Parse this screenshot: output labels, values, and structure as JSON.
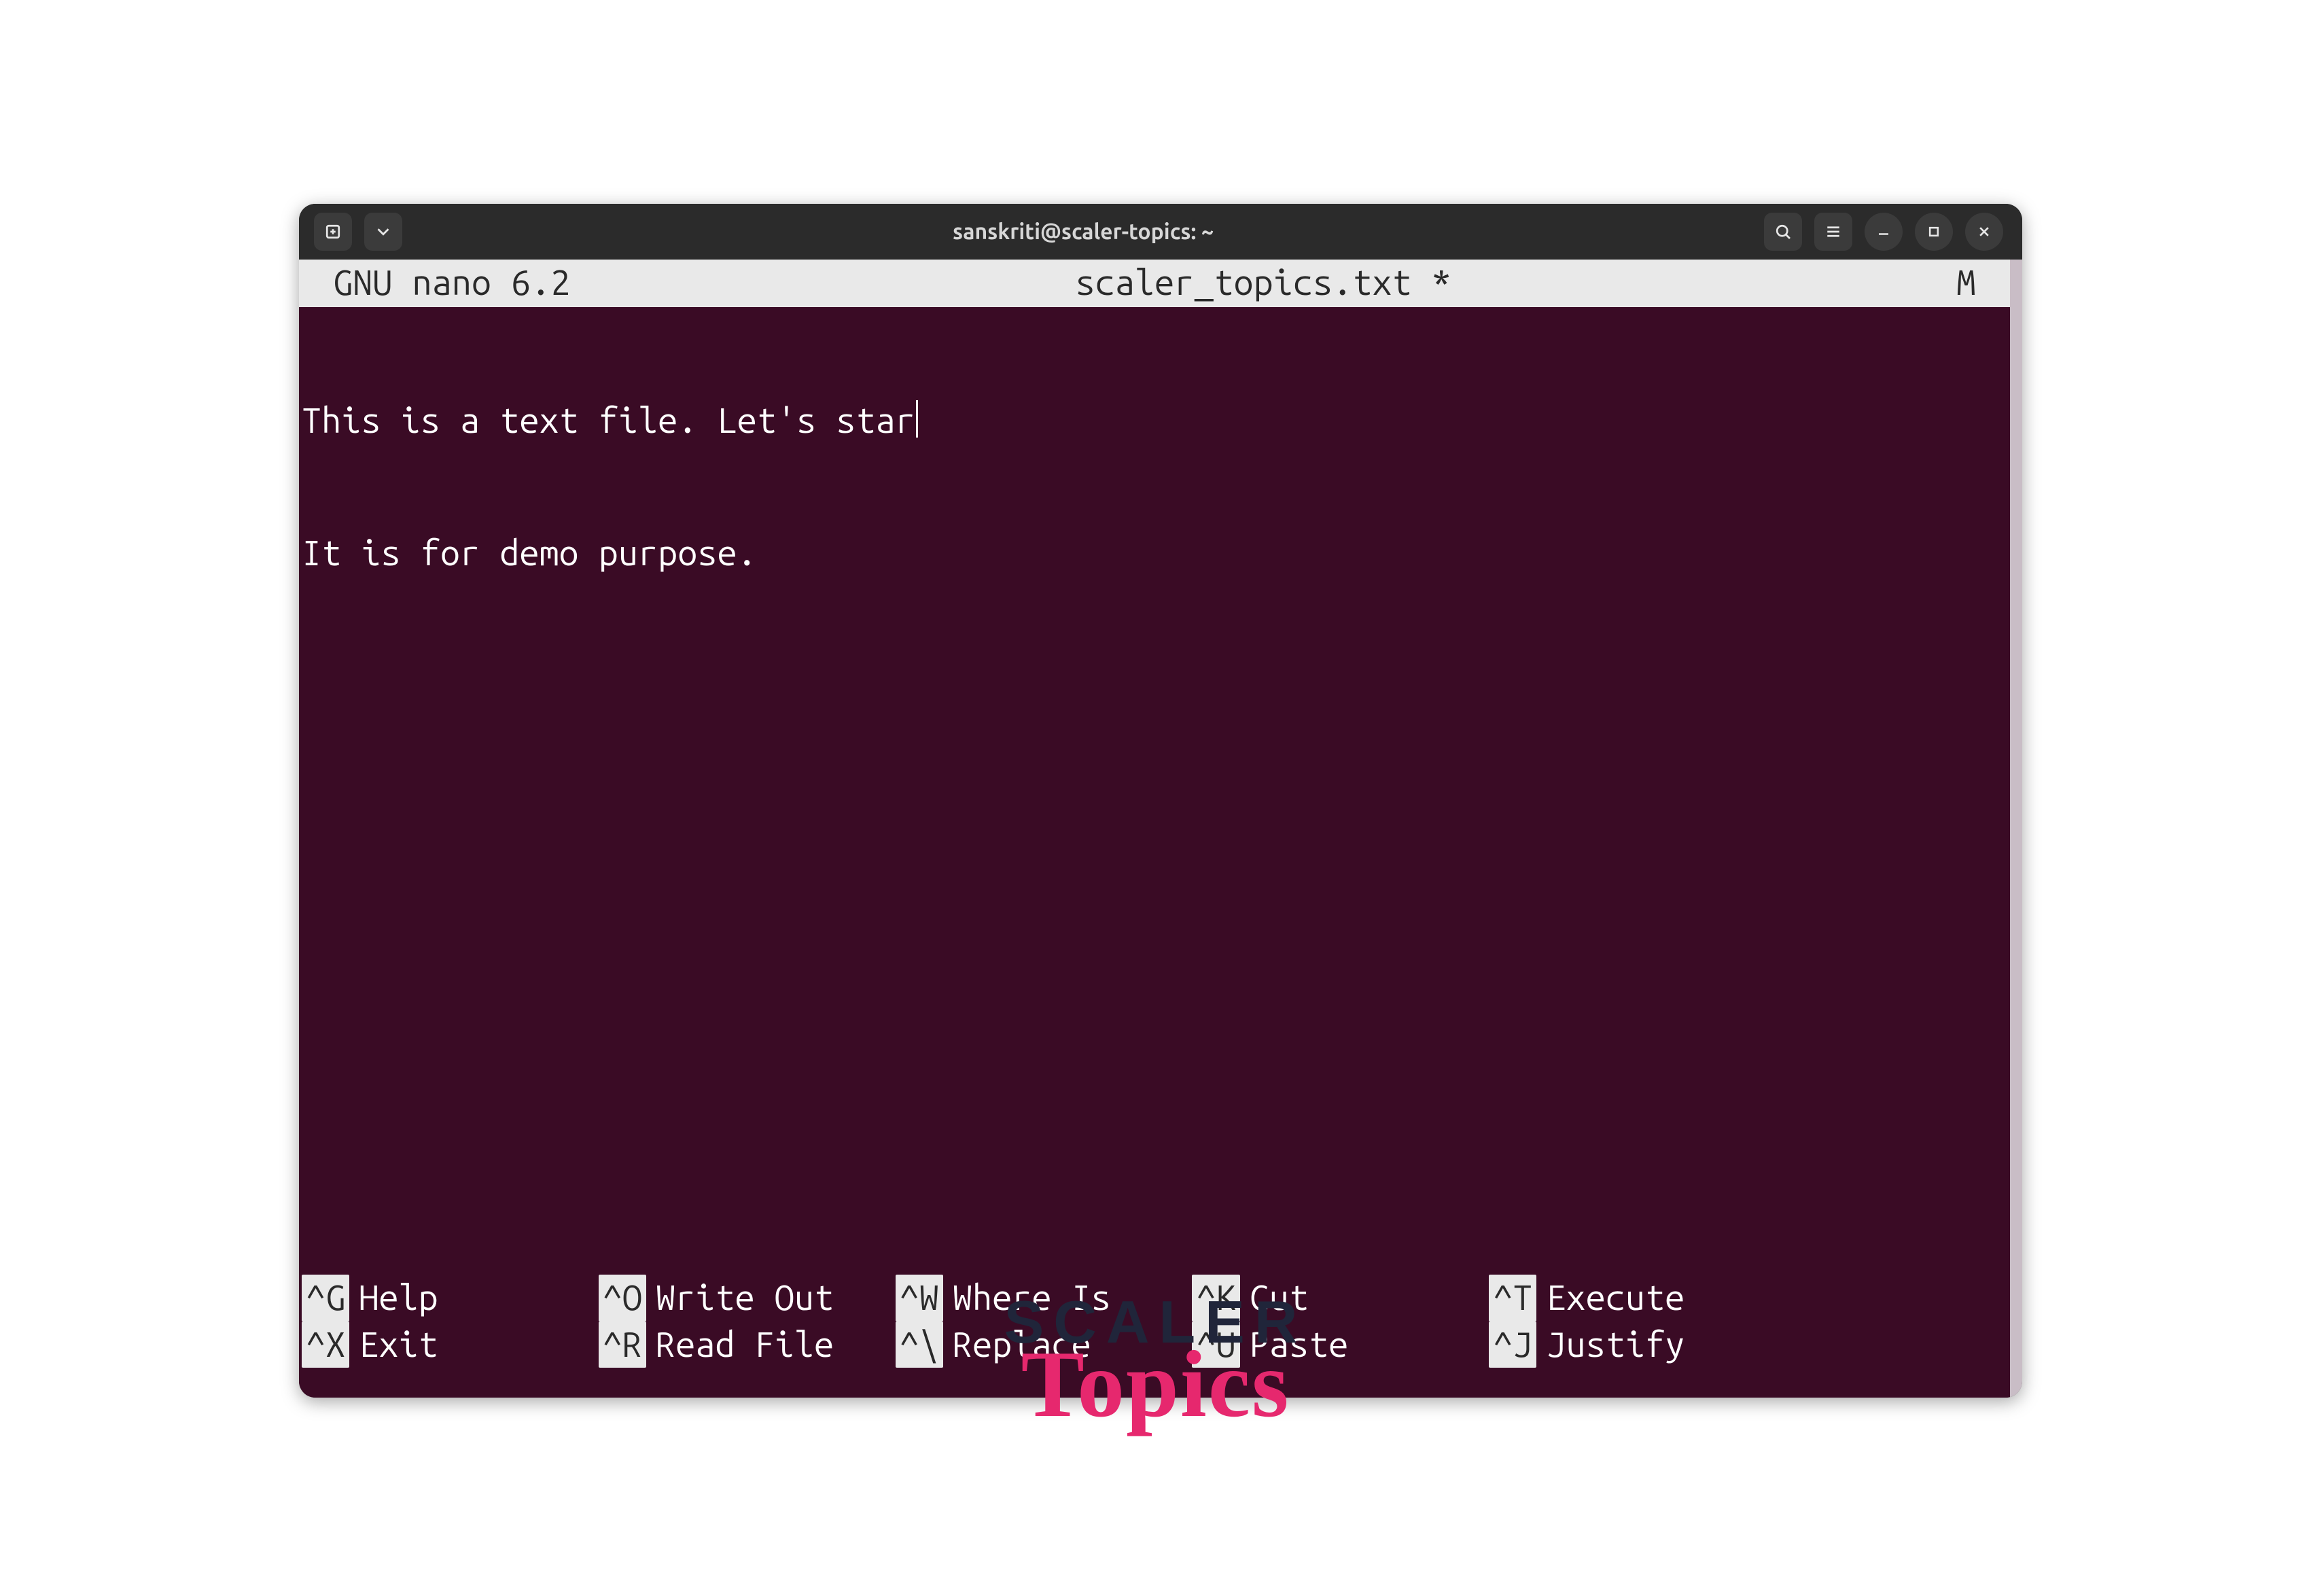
{
  "titlebar": {
    "title": "sanskriti@scaler-topics: ~"
  },
  "status": {
    "left": "GNU nano 6.2",
    "center": "scaler_topics.txt *",
    "right": "M"
  },
  "editor": {
    "lines": [
      "This is a text file. Let's star",
      "It is for demo purpose."
    ]
  },
  "shortcuts": {
    "row1": [
      {
        "key": "^G",
        "label": "Help"
      },
      {
        "key": "^O",
        "label": "Write Out"
      },
      {
        "key": "^W",
        "label": "Where Is"
      },
      {
        "key": "^K",
        "label": "Cut"
      },
      {
        "key": "^T",
        "label": "Execute"
      }
    ],
    "row2": [
      {
        "key": "^X",
        "label": "Exit"
      },
      {
        "key": "^R",
        "label": "Read File"
      },
      {
        "key": "^\\",
        "label": "Replace"
      },
      {
        "key": "^U",
        "label": "Paste"
      },
      {
        "key": "^J",
        "label": "Justify"
      }
    ]
  },
  "logo": {
    "top": "SCALER",
    "bottom": "Topics"
  }
}
